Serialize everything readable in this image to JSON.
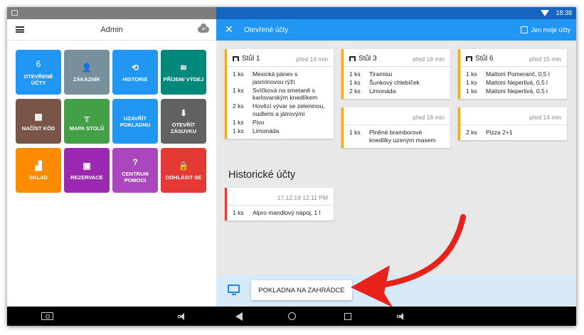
{
  "left_header": {
    "title": "Admin"
  },
  "tiles": [
    {
      "label": "OTEVŘENÉ ÚČTY",
      "number": "6",
      "icon": "number-badge",
      "color": "#2196f3"
    },
    {
      "label": "ZÁKAZNÍK",
      "icon": "person-icon",
      "glyph": "👤",
      "color": "#78909c"
    },
    {
      "label": "HISTORIE",
      "icon": "history-icon",
      "glyph": "⟲",
      "color": "#2196f3"
    },
    {
      "label": "PŘÍJEM/ VÝDEJ",
      "icon": "coins-icon",
      "glyph": "≋",
      "color": "#00897b"
    },
    {
      "label": "NAČÍST KÓD",
      "icon": "qr-icon",
      "glyph": "▦",
      "color": "#795548"
    },
    {
      "label": "MAPA STOLŮ",
      "icon": "table-icon",
      "glyph": "╥",
      "color": "#43a047"
    },
    {
      "label": "UZAVŘÍT POKLADNU",
      "icon": "",
      "glyph": "",
      "color": "#2196f3"
    },
    {
      "label": "OTEVŘÍT ZÁSUVKU",
      "icon": "download-icon",
      "glyph": "⬇",
      "color": "#616161"
    },
    {
      "label": "SKLAD",
      "icon": "forklift-icon",
      "glyph": "▟",
      "color": "#fb8c00"
    },
    {
      "label": "REZERVACE",
      "icon": "calendar-icon",
      "glyph": "▣",
      "color": "#9c27b0"
    },
    {
      "label": "CENTRUM POMOCI",
      "icon": "help-icon",
      "glyph": "?",
      "color": "#ab47bc"
    },
    {
      "label": "ODHLÁSIT SE",
      "icon": "lock-icon",
      "glyph": "🔒",
      "color": "#e53935"
    }
  ],
  "right_header": {
    "title": "Otevřené účty",
    "only_mine_label": "Jen moje účty"
  },
  "status_bar": {
    "time": "18:38"
  },
  "open_accounts": [
    {
      "table": "Stůl 1",
      "time": "před 14 min",
      "items": [
        {
          "qty": "1 ks",
          "name": "Mexická pánev s jasmínovou rýží"
        },
        {
          "qty": "1 ks",
          "name": "Svíčková na smetaně s karlovarským knedlíkem"
        },
        {
          "qty": "2 ks",
          "name": "Hovězí vývar se zeleninou, nudlemi a játrovými"
        },
        {
          "qty": "1 ks",
          "name": "Pivo"
        },
        {
          "qty": "1 ks",
          "name": "Limonáda"
        }
      ]
    },
    {
      "table": "Stůl 3",
      "time": "před 18 min",
      "items": [
        {
          "qty": "1 ks",
          "name": "Tiramisu"
        },
        {
          "qty": "1 ks",
          "name": "Šunkový chlebíček"
        },
        {
          "qty": "2 ks",
          "name": "Limonáda"
        }
      ]
    },
    {
      "table": "Stůl 6",
      "time": "před 15 min",
      "items": [
        {
          "qty": "1 ks",
          "name": "Mattoni Pomeranč, 0,5 l"
        },
        {
          "qty": "1 ks",
          "name": "Mattoni Neperlivá, 0,5 l"
        },
        {
          "qty": "1 ks",
          "name": "Mattoni Neperlivá, 0,5 l"
        }
      ]
    },
    {
      "table": "",
      "time": "před 18 min",
      "items": [
        {
          "qty": "1 ks",
          "name": "Plněné bramborové knedlíky uzeným masem"
        }
      ]
    },
    {
      "table": "",
      "time": "před 14 min",
      "items": [
        {
          "qty": "2 ks",
          "name": "Pizza 2+1"
        }
      ]
    }
  ],
  "historic": {
    "title": "Historické účty",
    "accounts": [
      {
        "time": "17.12.19 12:11 PM",
        "items": [
          {
            "qty": "1 ks",
            "name": "Alpro mandlový nápoj, 1 l"
          }
        ]
      }
    ]
  },
  "bottom": {
    "button_label": "POKLADNA NA ZAHRÁDCE"
  },
  "colors": {
    "accent": "#2196f3",
    "open_border": "#f5a623",
    "historic_border": "#e53935",
    "arrow": "#e8211a"
  }
}
